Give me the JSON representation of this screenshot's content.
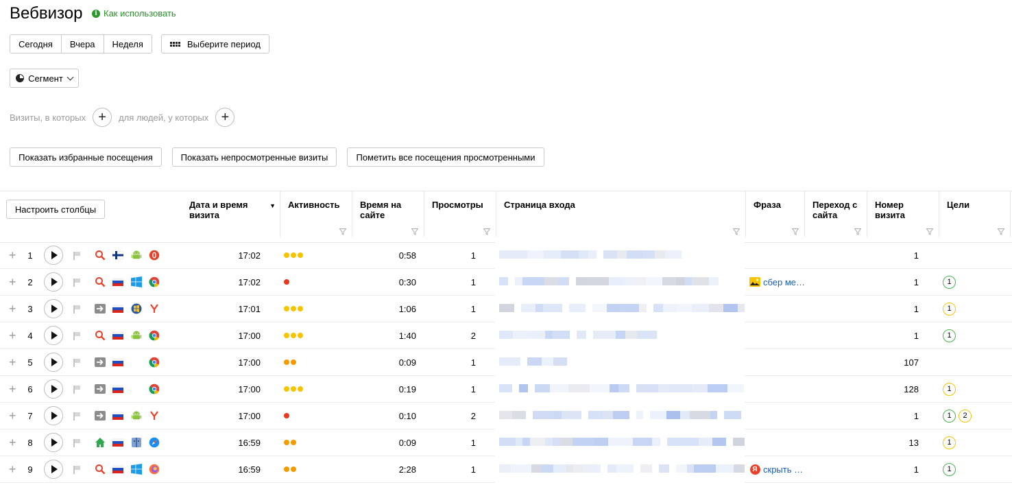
{
  "header": {
    "title": "Вебвизор",
    "howto": "Как использовать"
  },
  "period": {
    "today": "Сегодня",
    "yesterday": "Вчера",
    "week": "Неделя",
    "choose": "Выберите период"
  },
  "segment": {
    "label": "Сегмент"
  },
  "filters": {
    "visits_where": "Визиты, в которых",
    "people_where": "для людей, у которых"
  },
  "actions": {
    "favorites": "Показать избранные посещения",
    "unviewed": "Показать непросмотренные визиты",
    "mark_viewed": "Пометить все посещения просмотренными"
  },
  "table": {
    "configure": "Настроить столбцы",
    "columns": {
      "datetime": "Дата и время визита",
      "activity": "Активность",
      "time_on_site": "Время на сайте",
      "views": "Просмотры",
      "entry_page": "Страница входа",
      "phrase": "Фраза",
      "referrer": "Переход с сайта",
      "visit_number": "Номер визита",
      "goals": "Цели"
    },
    "rows": [
      {
        "n": "1",
        "source": "search",
        "country": "fi",
        "os": "android",
        "browser": "opera",
        "time": "17:02",
        "activity": 3,
        "activity_color": "#f5c400",
        "duration": "0:58",
        "views": "1",
        "phrase": "",
        "phrase_icon": "",
        "visit": "1",
        "goals": []
      },
      {
        "n": "2",
        "source": "search",
        "country": "ru",
        "os": "windows",
        "browser": "chrome",
        "time": "17:02",
        "activity": 1,
        "activity_color": "#e63a1e",
        "duration": "0:30",
        "views": "1",
        "phrase": "сбер ме…",
        "phrase_icon": "image",
        "visit": "1",
        "goals": [
          {
            "v": "1",
            "c": "green"
          }
        ]
      },
      {
        "n": "3",
        "source": "direct",
        "country": "ru",
        "os": "winxp",
        "browser": "yandex",
        "time": "17:01",
        "activity": 3,
        "activity_color": "#f5c400",
        "duration": "1:06",
        "views": "1",
        "phrase": "",
        "phrase_icon": "",
        "visit": "1",
        "goals": [
          {
            "v": "1",
            "c": "yellow"
          }
        ]
      },
      {
        "n": "4",
        "source": "search",
        "country": "ru",
        "os": "android",
        "browser": "chrome",
        "time": "17:00",
        "activity": 3,
        "activity_color": "#f5c400",
        "duration": "1:40",
        "views": "2",
        "phrase": "",
        "phrase_icon": "",
        "visit": "1",
        "goals": [
          {
            "v": "1",
            "c": "green"
          }
        ]
      },
      {
        "n": "5",
        "source": "direct",
        "country": "ru",
        "os": "",
        "browser": "chrome",
        "time": "17:00",
        "activity": 2,
        "activity_color": "#f59a00",
        "duration": "0:09",
        "views": "1",
        "phrase": "",
        "phrase_icon": "",
        "visit": "107",
        "goals": []
      },
      {
        "n": "6",
        "source": "direct",
        "country": "ru",
        "os": "",
        "browser": "chrome",
        "time": "17:00",
        "activity": 3,
        "activity_color": "#f5c400",
        "duration": "0:19",
        "views": "1",
        "phrase": "",
        "phrase_icon": "",
        "visit": "128",
        "goals": [
          {
            "v": "1",
            "c": "yellow"
          }
        ]
      },
      {
        "n": "7",
        "source": "direct",
        "country": "ru",
        "os": "android",
        "browser": "yandex",
        "time": "17:00",
        "activity": 1,
        "activity_color": "#e63a1e",
        "duration": "0:10",
        "views": "2",
        "phrase": "",
        "phrase_icon": "",
        "visit": "1",
        "goals": [
          {
            "v": "1",
            "c": "green"
          },
          {
            "v": "2",
            "c": "yellow"
          }
        ]
      },
      {
        "n": "8",
        "source": "internal",
        "country": "ru",
        "os": "mac",
        "browser": "safari",
        "time": "16:59",
        "activity": 2,
        "activity_color": "#f59a00",
        "duration": "0:09",
        "views": "1",
        "phrase": "",
        "phrase_icon": "",
        "visit": "13",
        "goals": [
          {
            "v": "1",
            "c": "yellow"
          }
        ]
      },
      {
        "n": "9",
        "source": "search",
        "country": "ru",
        "os": "windows",
        "browser": "firefox",
        "time": "16:59",
        "activity": 2,
        "activity_color": "#f59a00",
        "duration": "2:28",
        "views": "1",
        "phrase": "скрыть …",
        "phrase_icon": "yandex",
        "visit": "1",
        "goals": [
          {
            "v": "1",
            "c": "green"
          }
        ]
      }
    ]
  }
}
